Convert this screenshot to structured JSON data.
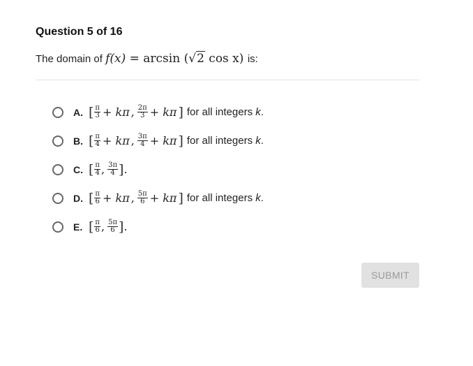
{
  "question": {
    "header": "Question 5 of 16",
    "prompt_prefix": "The domain of",
    "prompt_math_fx": "f(x) =",
    "prompt_math_fn": "arcsin",
    "prompt_math_sqrt": "2",
    "prompt_math_cos": "cos x",
    "prompt_suffix": "is:"
  },
  "options": [
    {
      "label": "A.",
      "num1": "π",
      "den1": "3",
      "num2": "2π",
      "den2": "3",
      "suffix_text": "for all integers",
      "suffix_var": "k",
      "period": ".",
      "variant": "kpi"
    },
    {
      "label": "B.",
      "num1": "π",
      "den1": "4",
      "num2": "3π",
      "den2": "4",
      "suffix_text": "for all integers",
      "suffix_var": "k",
      "period": ".",
      "variant": "kpi"
    },
    {
      "label": "C.",
      "num1": "π",
      "den1": "4",
      "num2": "3π",
      "den2": "4",
      "period": ".",
      "variant": "plain"
    },
    {
      "label": "D.",
      "num1": "π",
      "den1": "6",
      "num2": "5π",
      "den2": "6",
      "suffix_text": "for all integers",
      "suffix_var": "k",
      "period": ".",
      "variant": "kpi"
    },
    {
      "label": "E.",
      "num1": "π",
      "den1": "6",
      "num2": "5π",
      "den2": "6",
      "period": ".",
      "variant": "plain"
    }
  ],
  "math_terms": {
    "plus_kpi": "+ kπ",
    "comma": ","
  },
  "submit": {
    "label": "SUBMIT"
  }
}
